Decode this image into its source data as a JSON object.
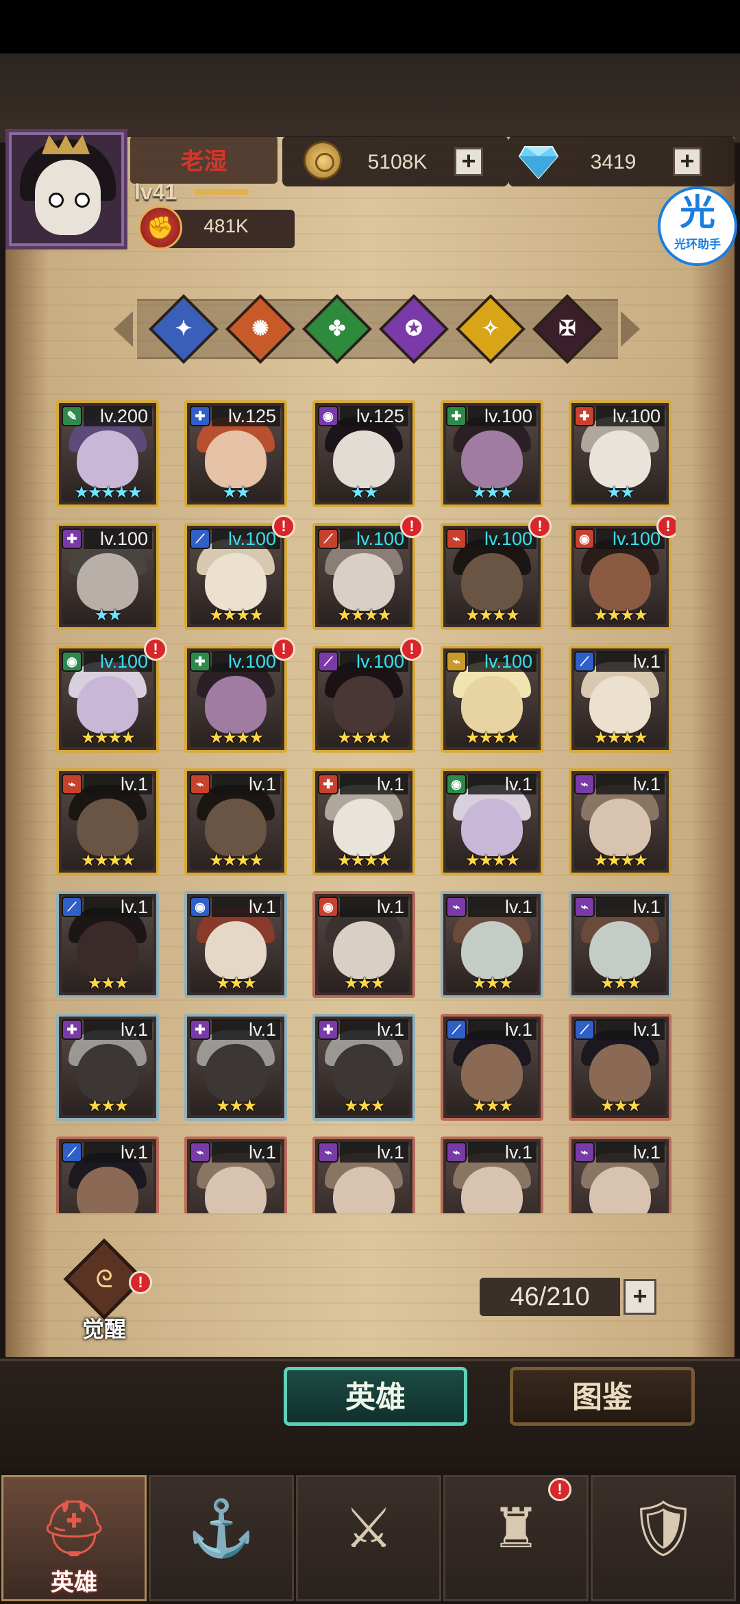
{
  "player": {
    "name": "老湿",
    "level": "lv41",
    "power": "481K"
  },
  "resources": {
    "gold": "5108K",
    "diamonds": "3419"
  },
  "overlay_badge": {
    "glyph": "光",
    "label": "光环助手"
  },
  "filters": [
    {
      "id": "all",
      "color": "#3a5fb8",
      "glyph": "✦"
    },
    {
      "id": "fire",
      "color": "#c85a2a",
      "glyph": "✺"
    },
    {
      "id": "nature",
      "color": "#2e8a3c",
      "glyph": "✤"
    },
    {
      "id": "arcane",
      "color": "#7a3aa8",
      "glyph": "✪"
    },
    {
      "id": "light",
      "color": "#d8a418",
      "glyph": "✧"
    },
    {
      "id": "dark",
      "color": "#3a1f2a",
      "glyph": "✠"
    }
  ],
  "heroes": [
    {
      "level": "lv.200",
      "stars": "★★★★★",
      "frame": "gold",
      "elem": "#2e8a4c",
      "glyph": "✎",
      "tone": "#c9b7d8",
      "hair": "#5c4a78",
      "alert": false,
      "lvcolor": "white",
      "starcolor": "mixed"
    },
    {
      "level": "lv.125",
      "stars": "★★",
      "frame": "gold",
      "elem": "#2f5fc8",
      "glyph": "✚",
      "tone": "#e6c2a6",
      "hair": "#b8502f",
      "alert": false,
      "lvcolor": "white",
      "starcolor": "cyan"
    },
    {
      "level": "lv.125",
      "stars": "★★",
      "frame": "gold",
      "elem": "#7a3aa8",
      "glyph": "◉",
      "tone": "#e2dcd4",
      "hair": "#1b1418",
      "alert": false,
      "lvcolor": "white",
      "starcolor": "cyan"
    },
    {
      "level": "lv.100",
      "stars": "★★★",
      "frame": "gold",
      "elem": "#2e8a4c",
      "glyph": "✚",
      "tone": "#a07ca2",
      "hair": "#2a1f24",
      "alert": false,
      "lvcolor": "white",
      "starcolor": "cyan"
    },
    {
      "level": "lv.100",
      "stars": "★★",
      "frame": "gold",
      "elem": "#c8412f",
      "glyph": "✚",
      "tone": "#e8e4dc",
      "hair": "#b0a89a",
      "alert": false,
      "lvcolor": "white",
      "starcolor": "cyan"
    },
    {
      "level": "lv.100",
      "stars": "★★",
      "frame": "gold",
      "elem": "#7a3aa8",
      "glyph": "✚",
      "tone": "#b8b0a8",
      "hair": "#4a4440",
      "alert": false,
      "lvcolor": "white",
      "starcolor": "cyan"
    },
    {
      "level": "lv.100",
      "stars": "★★★★",
      "frame": "gold",
      "elem": "#2f5fc8",
      "glyph": "⟋",
      "tone": "#ece0cf",
      "hair": "#d8c8b0",
      "alert": true,
      "lvcolor": "cyan",
      "starcolor": "gold"
    },
    {
      "level": "lv.100",
      "stars": "★★★★",
      "frame": "gold",
      "elem": "#c8412f",
      "glyph": "⟋",
      "tone": "#d8cfc6",
      "hair": "#8a7e76",
      "alert": true,
      "lvcolor": "cyan",
      "starcolor": "gold"
    },
    {
      "level": "lv.100",
      "stars": "★★★★",
      "frame": "gold",
      "elem": "#c8412f",
      "glyph": "⌁",
      "tone": "#6a5444",
      "hair": "#1c1612",
      "alert": true,
      "lvcolor": "cyan",
      "starcolor": "gold"
    },
    {
      "level": "lv.100",
      "stars": "★★★★",
      "frame": "gold",
      "elem": "#c8412f",
      "glyph": "◉",
      "tone": "#8a5a42",
      "hair": "#2a1c18",
      "alert": true,
      "lvcolor": "cyan",
      "starcolor": "gold"
    },
    {
      "level": "lv.100",
      "stars": "★★★★",
      "frame": "gold",
      "elem": "#2e8a4c",
      "glyph": "◉",
      "tone": "#c9b7d8",
      "hair": "#d8d0dc",
      "alert": true,
      "lvcolor": "cyan",
      "starcolor": "gold"
    },
    {
      "level": "lv.100",
      "stars": "★★★★",
      "frame": "gold",
      "elem": "#2e8a4c",
      "glyph": "✚",
      "tone": "#a07ca2",
      "hair": "#2a1f24",
      "alert": true,
      "lvcolor": "cyan",
      "starcolor": "gold"
    },
    {
      "level": "lv.100",
      "stars": "★★★★",
      "frame": "gold",
      "elem": "#7a3aa8",
      "glyph": "⟋",
      "tone": "#4a3634",
      "hair": "#1a1214",
      "alert": true,
      "lvcolor": "cyan",
      "starcolor": "gold"
    },
    {
      "level": "lv.100",
      "stars": "★★★★",
      "frame": "gold",
      "elem": "#c89a2a",
      "glyph": "⌁",
      "tone": "#e8d4a2",
      "hair": "#f2e4b0",
      "alert": false,
      "lvcolor": "cyan",
      "starcolor": "gold"
    },
    {
      "level": "lv.1",
      "stars": "★★★★",
      "frame": "gold",
      "elem": "#2f5fc8",
      "glyph": "⟋",
      "tone": "#ece0cf",
      "hair": "#d8c8b0",
      "alert": false,
      "lvcolor": "white",
      "starcolor": "gold"
    },
    {
      "level": "lv.1",
      "stars": "★★★★",
      "frame": "gold",
      "elem": "#c8412f",
      "glyph": "⌁",
      "tone": "#6a5444",
      "hair": "#1c1612",
      "alert": false,
      "lvcolor": "white",
      "starcolor": "gold"
    },
    {
      "level": "lv.1",
      "stars": "★★★★",
      "frame": "gold",
      "elem": "#c8412f",
      "glyph": "⌁",
      "tone": "#6a5444",
      "hair": "#1c1612",
      "alert": false,
      "lvcolor": "white",
      "starcolor": "gold"
    },
    {
      "level": "lv.1",
      "stars": "★★★★",
      "frame": "gold",
      "elem": "#c8412f",
      "glyph": "✚",
      "tone": "#e8e4dc",
      "hair": "#b0a89a",
      "alert": false,
      "lvcolor": "white",
      "starcolor": "gold"
    },
    {
      "level": "lv.1",
      "stars": "★★★★",
      "frame": "gold",
      "elem": "#2e8a4c",
      "glyph": "◉",
      "tone": "#c9b7d8",
      "hair": "#d8d0dc",
      "alert": false,
      "lvcolor": "white",
      "starcolor": "gold"
    },
    {
      "level": "lv.1",
      "stars": "★★★★",
      "frame": "gold",
      "elem": "#7a3aa8",
      "glyph": "⌁",
      "tone": "#d8c2b0",
      "hair": "#8a7464",
      "alert": false,
      "lvcolor": "white",
      "starcolor": "gold"
    },
    {
      "level": "lv.1",
      "stars": "★★★",
      "frame": "silver",
      "elem": "#2f5fc8",
      "glyph": "⟋",
      "tone": "#3a2a2a",
      "hair": "#1c1616",
      "alert": false,
      "lvcolor": "white",
      "starcolor": "gold"
    },
    {
      "level": "lv.1",
      "stars": "★★★",
      "frame": "silver",
      "elem": "#2f5fc8",
      "glyph": "◉",
      "tone": "#e6d8c6",
      "hair": "#8a3a2a",
      "alert": false,
      "lvcolor": "white",
      "starcolor": "gold"
    },
    {
      "level": "lv.1",
      "stars": "★★★",
      "frame": "bronze",
      "elem": "#c8412f",
      "glyph": "◉",
      "tone": "#d8d0c4",
      "hair": "#3a3230",
      "alert": false,
      "lvcolor": "white",
      "starcolor": "gold"
    },
    {
      "level": "lv.1",
      "stars": "★★★",
      "frame": "silver",
      "elem": "#7a3aa8",
      "glyph": "⌁",
      "tone": "#c4ccc8",
      "hair": "#6a4a3a",
      "alert": false,
      "lvcolor": "white",
      "starcolor": "gold"
    },
    {
      "level": "lv.1",
      "stars": "★★★",
      "frame": "silver",
      "elem": "#7a3aa8",
      "glyph": "⌁",
      "tone": "#c4ccc8",
      "hair": "#6a4a3a",
      "alert": false,
      "lvcolor": "white",
      "starcolor": "gold"
    },
    {
      "level": "lv.1",
      "stars": "★★★",
      "frame": "silver",
      "elem": "#7a3aa8",
      "glyph": "✚",
      "tone": "#3c3634",
      "hair": "#9a9894",
      "alert": false,
      "lvcolor": "white",
      "starcolor": "gold"
    },
    {
      "level": "lv.1",
      "stars": "★★★",
      "frame": "silver",
      "elem": "#7a3aa8",
      "glyph": "✚",
      "tone": "#3c3634",
      "hair": "#9a9894",
      "alert": false,
      "lvcolor": "white",
      "starcolor": "gold"
    },
    {
      "level": "lv.1",
      "stars": "★★★",
      "frame": "silver",
      "elem": "#7a3aa8",
      "glyph": "✚",
      "tone": "#3c3634",
      "hair": "#9a9894",
      "alert": false,
      "lvcolor": "white",
      "starcolor": "gold"
    },
    {
      "level": "lv.1",
      "stars": "★★★",
      "frame": "bronze",
      "elem": "#2f5fc8",
      "glyph": "⟋",
      "tone": "#8a6a54",
      "hair": "#1c1820",
      "alert": false,
      "lvcolor": "white",
      "starcolor": "gold"
    },
    {
      "level": "lv.1",
      "stars": "★★★",
      "frame": "bronze",
      "elem": "#2f5fc8",
      "glyph": "⟋",
      "tone": "#8a6a54",
      "hair": "#1c1820",
      "alert": false,
      "lvcolor": "white",
      "starcolor": "gold"
    },
    {
      "level": "lv.1",
      "stars": "★★★",
      "frame": "bronze",
      "elem": "#2f5fc8",
      "glyph": "⟋",
      "tone": "#8a6a54",
      "hair": "#1c1820",
      "alert": false,
      "lvcolor": "white",
      "starcolor": "gold"
    },
    {
      "level": "lv.1",
      "stars": "★★★",
      "frame": "bronze",
      "elem": "#7a3aa8",
      "glyph": "⌁",
      "tone": "#d8c2b0",
      "hair": "#8a7464",
      "alert": false,
      "lvcolor": "white",
      "starcolor": "gold"
    },
    {
      "level": "lv.1",
      "stars": "★★★",
      "frame": "bronze",
      "elem": "#7a3aa8",
      "glyph": "⌁",
      "tone": "#d8c2b0",
      "hair": "#8a7464",
      "alert": false,
      "lvcolor": "white",
      "starcolor": "gold"
    },
    {
      "level": "lv.1",
      "stars": "★★★",
      "frame": "bronze",
      "elem": "#7a3aa8",
      "glyph": "⌁",
      "tone": "#d8c2b0",
      "hair": "#8a7464",
      "alert": false,
      "lvcolor": "white",
      "starcolor": "gold"
    },
    {
      "level": "lv.1",
      "stars": "★★★",
      "frame": "bronze",
      "elem": "#7a3aa8",
      "glyph": "⌁",
      "tone": "#d8c2b0",
      "hair": "#8a7464",
      "alert": false,
      "lvcolor": "white",
      "starcolor": "gold"
    }
  ],
  "awaken": {
    "label": "觉醒"
  },
  "hero_count": "46/210",
  "tabs": {
    "heroes": "英雄",
    "codex": "图鉴"
  },
  "nav": [
    {
      "id": "heroes",
      "label": "英雄",
      "icon": "⛑",
      "active": true
    },
    {
      "id": "adventure",
      "label": "",
      "icon": "⚓",
      "active": false
    },
    {
      "id": "battle",
      "label": "",
      "icon": "⚔",
      "active": false
    },
    {
      "id": "castle",
      "label": "",
      "icon": "♜",
      "active": false
    },
    {
      "id": "guild",
      "label": "",
      "icon": "🛡",
      "active": false
    }
  ]
}
